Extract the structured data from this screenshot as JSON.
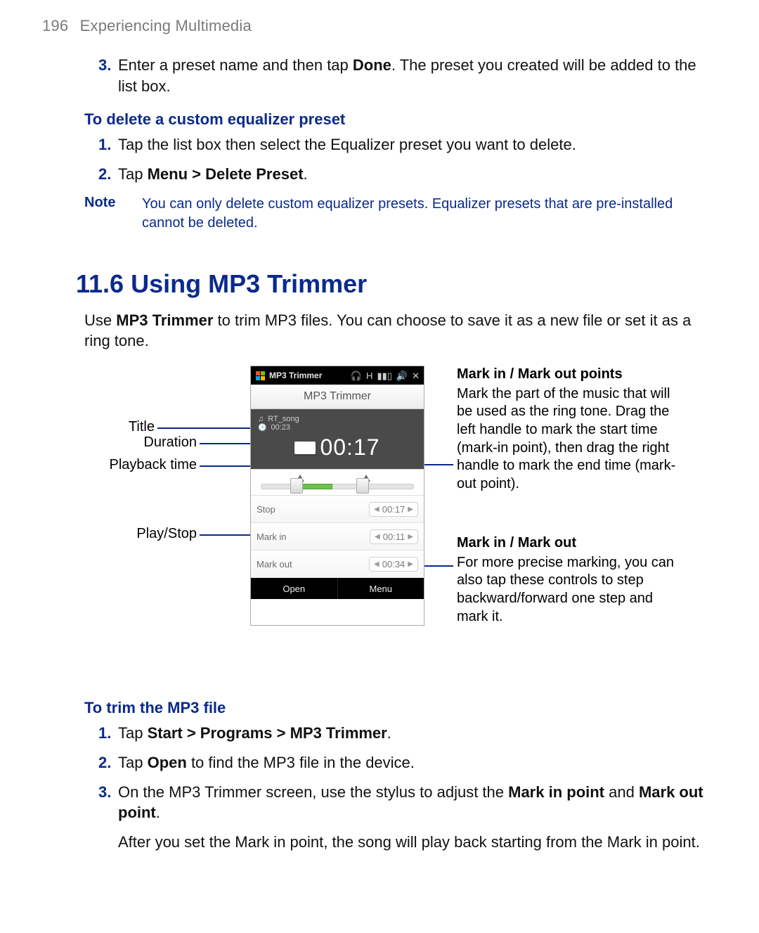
{
  "page": {
    "number": "196",
    "chapter": "Experiencing Multimedia"
  },
  "step3": {
    "num": "3.",
    "pre": "Enter a preset name and then tap ",
    "bold": "Done",
    "post": ". The preset you created will be added to the list box."
  },
  "delete_preset": {
    "heading": "To delete a custom equalizer preset",
    "s1": {
      "num": "1.",
      "text": "Tap the list box then select the Equalizer preset you want to delete."
    },
    "s2": {
      "num": "2.",
      "pre": "Tap ",
      "bold": "Menu > Delete Preset",
      "post": "."
    }
  },
  "note": {
    "label": "Note",
    "text": "You can only delete custom equalizer presets. Equalizer presets that are pre-installed cannot be deleted."
  },
  "section": {
    "title": "11.6  Using MP3 Trimmer",
    "intro_pre": "Use ",
    "intro_bold": "MP3 Trimmer",
    "intro_post": " to trim MP3 files. You can choose to save it as a new file or set it as a ring tone."
  },
  "labels": {
    "title": "Title",
    "duration": "Duration",
    "playback": "Playback time",
    "playstop": "Play/Stop"
  },
  "callouts": {
    "points": {
      "head": "Mark in / Mark out points",
      "body": "Mark the part of the music that will be used as the ring tone. Drag the left handle to mark the start time (mark-in point), then drag the right handle to mark the end time (mark-out point)."
    },
    "controls": {
      "head": "Mark in / Mark out",
      "body": "For more precise marking, you can also tap these controls to step backward/forward one step and mark it."
    }
  },
  "device": {
    "titlebar": "MP3 Trimmer",
    "subtitle": "MP3 Trimmer",
    "song": "RT_song",
    "duration": "00:23",
    "bigtime": "00:17",
    "rows": {
      "stop": {
        "label": "Stop",
        "time": "00:17"
      },
      "markin": {
        "label": "Mark in",
        "time": "00:11"
      },
      "markout": {
        "label": "Mark out",
        "time": "00:34"
      }
    },
    "soft": {
      "open": "Open",
      "menu": "Menu"
    }
  },
  "trim": {
    "heading": "To trim the MP3 file",
    "s1": {
      "num": "1.",
      "pre": "Tap ",
      "bold": "Start > Programs > MP3 Trimmer",
      "post": "."
    },
    "s2": {
      "num": "2.",
      "pre": "Tap ",
      "bold": "Open",
      "post": " to find the MP3 file in the device."
    },
    "s3": {
      "num": "3.",
      "pre": "On the MP3 Trimmer screen, use the stylus to adjust the ",
      "b1": "Mark in point",
      "mid": " and ",
      "b2": "Mark out point",
      "post": "."
    },
    "after": "After you set the Mark in point, the song will play back starting from the Mark in point."
  }
}
